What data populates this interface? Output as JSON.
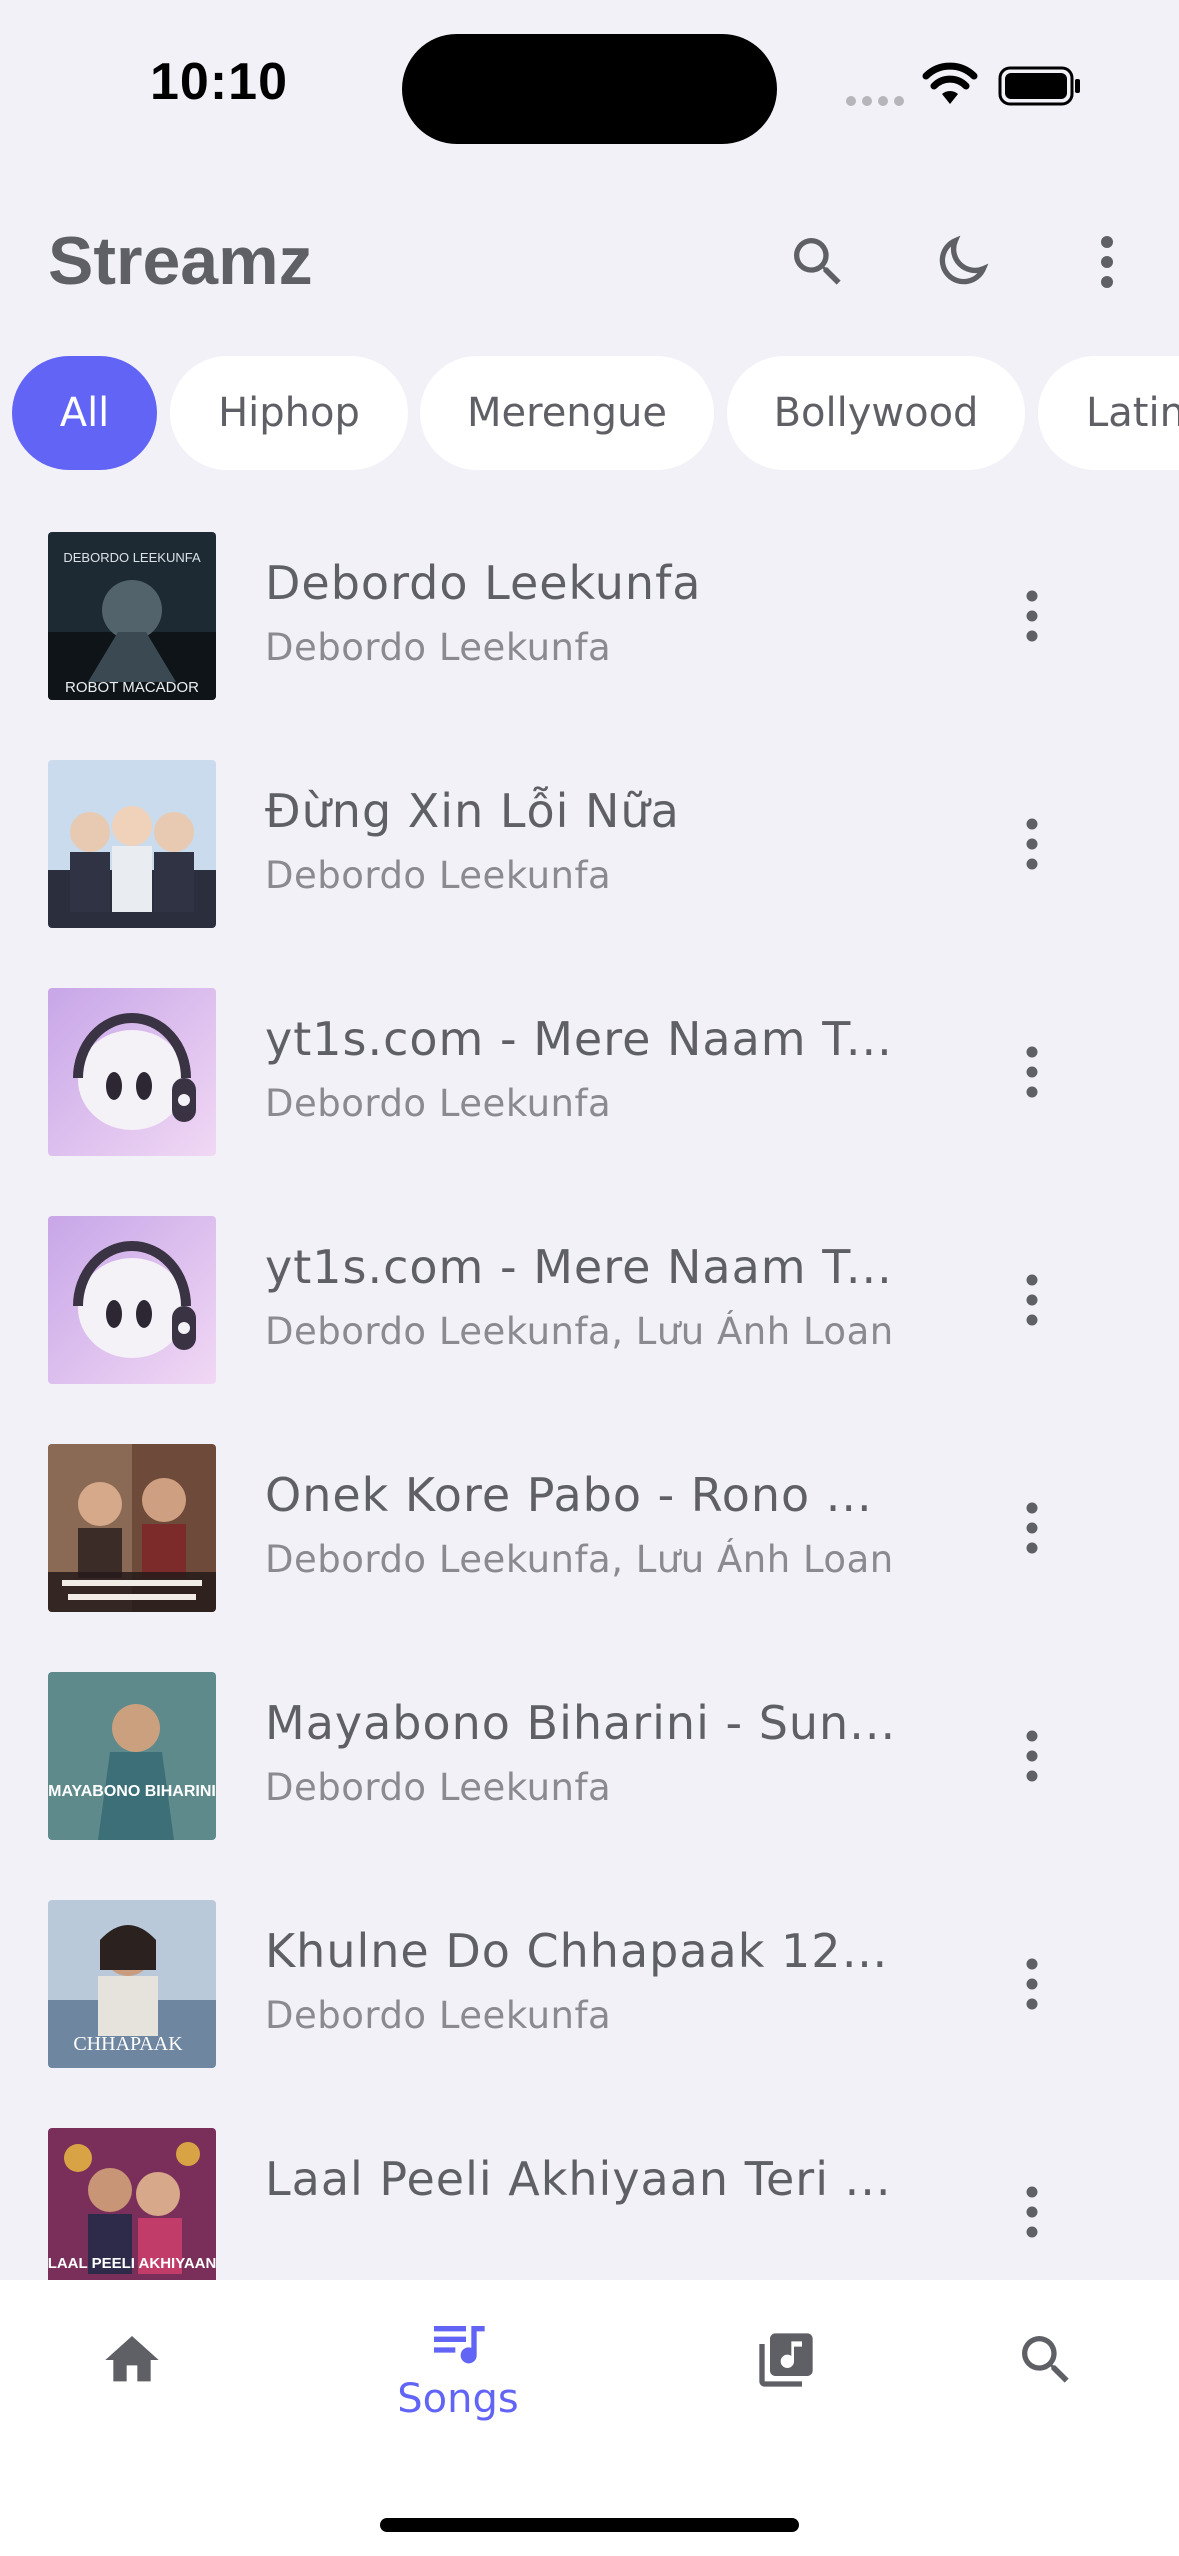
{
  "status_bar": {
    "time": "10:10"
  },
  "app_bar": {
    "title": "Streamz",
    "icons": [
      "search-icon",
      "dark-mode-icon",
      "more-vert-icon"
    ]
  },
  "filter_chips": [
    {
      "label": "All",
      "active": true
    },
    {
      "label": "Hiphop",
      "active": false
    },
    {
      "label": "Merengue",
      "active": false
    },
    {
      "label": "Bollywood",
      "active": false
    },
    {
      "label": "Latin",
      "active": false
    }
  ],
  "songs": [
    {
      "title": "Debordo Leekunfa",
      "artist": "Debordo Leekunfa"
    },
    {
      "title": "Đừng Xin Lỗi Nữa",
      "artist": "Debordo Leekunfa"
    },
    {
      "title": "yt1s.com - Mere Naam T...",
      "artist": "Debordo Leekunfa"
    },
    {
      "title": "yt1s.com - Mere Naam T...",
      "artist": "Debordo Leekunfa, Lưu Ánh Loan"
    },
    {
      "title": "Onek Kore Pabo - Rono ...",
      "artist": "Debordo Leekunfa, Lưu Ánh Loan"
    },
    {
      "title": "Mayabono Biharini - Sun...",
      "artist": "Debordo Leekunfa"
    },
    {
      "title": "Khulne Do Chhapaak 128...",
      "artist": "Debordo Leekunfa"
    },
    {
      "title": "Laal Peeli Akhiyaan Teri ...",
      "artist": ""
    }
  ],
  "artwork_text": {
    "cover1_top": "DEBORDO LEEKUNFA",
    "cover1_bottom": "ROBOT MACADOR",
    "cover6": "MAYABONO BIHARINI",
    "cover7": "CHHAPAAK",
    "cover8": "LAAL PEELI AKHIYAAN"
  },
  "bottom_nav": {
    "items": [
      {
        "icon": "home-icon",
        "label": ""
      },
      {
        "icon": "queue-music-icon",
        "label": "Songs",
        "active": true
      },
      {
        "icon": "library-music-icon",
        "label": ""
      },
      {
        "icon": "search-icon",
        "label": ""
      }
    ]
  },
  "colors": {
    "accent": "#6264f5",
    "background": "#f2f1f7",
    "text": "#5f5f66",
    "subtext": "#8a8a90"
  }
}
